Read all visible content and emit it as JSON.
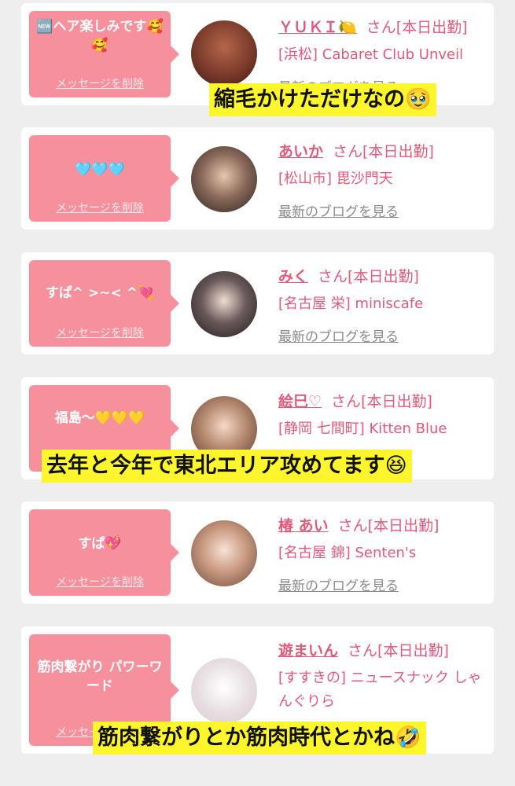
{
  "delete_label": "メッセージを削除",
  "san_label": "さん",
  "status_label": "[本日出勤]",
  "blog_label": "最新のブログを見る",
  "cards": [
    {
      "message": "🆕ヘア楽しみです🥰🥰",
      "name": "ＹＵＫＩ🍋",
      "shop": "[浜松] Cabaret Club Unveil",
      "caption": "縮毛かけただけなの🥹"
    },
    {
      "message": "🩵🩵🩵",
      "name": "あいか",
      "shop": "[松山市] 毘沙門天"
    },
    {
      "message": "すぱ^ >~< ^💘",
      "name": "みく",
      "shop": "[名古屋 栄] miniscafe"
    },
    {
      "message": "福島〜💛💛💛",
      "name": "絵巳♡",
      "shop": "[静岡 七間町] Kitten Blue",
      "caption": "去年と今年で東北エリア攻めてます😆"
    },
    {
      "message": "すぱ💖",
      "name": "椿 あい",
      "shop": "[名古屋 錦] Senten's"
    },
    {
      "message": "筋肉繋がり パワーワード",
      "name": "遊まいん",
      "shop": "[すすきの] ニュースナック しゃんぐりら",
      "caption": "筋肉繋がりとか筋肉時代とかね🤣"
    }
  ]
}
